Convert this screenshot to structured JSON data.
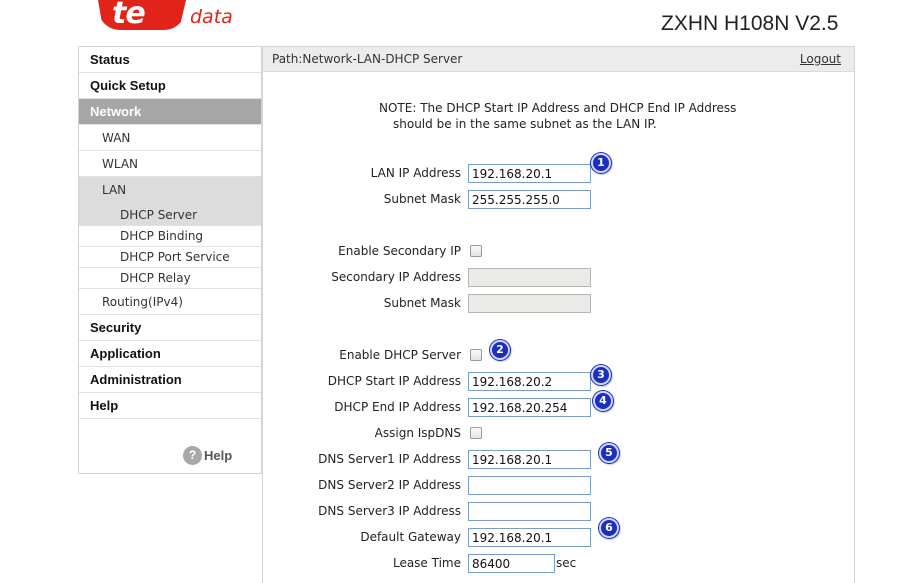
{
  "header": {
    "logo_main": "te",
    "logo_data": "data",
    "model": "ZXHN H108N V2.5"
  },
  "sidebar": {
    "items": [
      {
        "label": "Status"
      },
      {
        "label": "Quick Setup"
      },
      {
        "label": "Network"
      },
      {
        "label": "WAN"
      },
      {
        "label": "WLAN"
      },
      {
        "label": "LAN"
      },
      {
        "label": "DHCP Server"
      },
      {
        "label": "DHCP Binding"
      },
      {
        "label": "DHCP Port Service"
      },
      {
        "label": "DHCP Relay"
      },
      {
        "label": "Routing(IPv4)"
      },
      {
        "label": "Security"
      },
      {
        "label": "Application"
      },
      {
        "label": "Administration"
      },
      {
        "label": "Help"
      }
    ],
    "help_link": "Help",
    "help_glyph": "?"
  },
  "pathbar": {
    "path": "Path:Network-LAN-DHCP Server",
    "logout": "Logout"
  },
  "note": {
    "line1": "NOTE: The DHCP Start IP Address and DHCP End IP Address",
    "line2": "should be in the same subnet as the LAN IP."
  },
  "form": {
    "lan_ip_label": "LAN IP Address",
    "lan_ip_value": "192.168.20.1",
    "subnet_mask_label": "Subnet Mask",
    "subnet_mask_value": "255.255.255.0",
    "enable_secondary_ip_label": "Enable Secondary IP",
    "secondary_ip_label": "Secondary IP Address",
    "secondary_subnet_label": "Subnet Mask",
    "enable_dhcp_label": "Enable DHCP Server",
    "dhcp_start_label": "DHCP Start IP Address",
    "dhcp_start_value": "192.168.20.2",
    "dhcp_end_label": "DHCP End IP Address",
    "dhcp_end_value": "192.168.20.254",
    "assign_isp_dns_label": "Assign IspDNS",
    "dns1_label": "DNS Server1 IP Address",
    "dns1_value": "192.168.20.1",
    "dns2_label": "DNS Server2 IP Address",
    "dns2_value": "",
    "dns3_label": "DNS Server3 IP Address",
    "dns3_value": "",
    "gateway_label": "Default Gateway",
    "gateway_value": "192.168.20.1",
    "lease_label": "Lease Time",
    "lease_value": "86400",
    "lease_unit": "sec"
  },
  "markers": [
    "1",
    "2",
    "3",
    "4",
    "5",
    "6"
  ],
  "colors": {
    "brand_red": "#e2231a",
    "active_nav": "#a6a6a6",
    "marker_blue": "#1a2ec0"
  }
}
